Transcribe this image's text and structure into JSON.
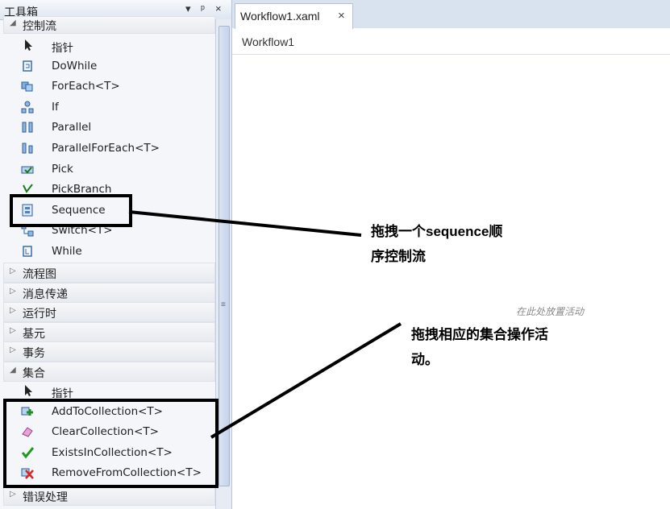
{
  "toolbox": {
    "title": "工具箱",
    "title_icons": [
      "▾",
      "ᵖ",
      "×"
    ],
    "open_category": "控制流",
    "control_flow_items": [
      {
        "label": "指针",
        "icon": "pointer-icon"
      },
      {
        "label": "DoWhile",
        "icon": "dowhile-icon"
      },
      {
        "label": "ForEach<T>",
        "icon": "foreach-icon"
      },
      {
        "label": "If",
        "icon": "if-icon"
      },
      {
        "label": "Parallel",
        "icon": "parallel-icon"
      },
      {
        "label": "ParallelForEach<T>",
        "icon": "parallel-foreach-icon"
      },
      {
        "label": "Pick",
        "icon": "pick-icon"
      },
      {
        "label": "PickBranch",
        "icon": "pickbranch-icon"
      },
      {
        "label": "Sequence",
        "icon": "sequence-icon"
      },
      {
        "label": "Switch<T>",
        "icon": "switch-icon"
      },
      {
        "label": "While",
        "icon": "while-icon"
      }
    ],
    "collapsed_categories": [
      "流程图",
      "消息传递",
      "运行时",
      "基元",
      "事务"
    ],
    "collection_category": "集合",
    "collection_items": [
      {
        "label": "指针",
        "icon": "pointer-icon"
      },
      {
        "label": "AddToCollection<T>",
        "icon": "add-to-collection-icon"
      },
      {
        "label": "ClearCollection<T>",
        "icon": "clear-collection-icon"
      },
      {
        "label": "ExistsInCollection<T>",
        "icon": "exists-in-collection-icon"
      },
      {
        "label": "RemoveFromCollection<T>",
        "icon": "remove-from-collection-icon"
      }
    ],
    "bottom_category": "错误处理"
  },
  "designer": {
    "tab_label": "Workflow1.xaml",
    "tab_close": "×",
    "breadcrumb": "Workflow1",
    "drop_hint": "在此处放置活动"
  },
  "annotations": {
    "note1": [
      "拖拽一个sequence顺",
      "序控制流"
    ],
    "note2": [
      "拖拽相应的集合操作活",
      "动。"
    ]
  }
}
